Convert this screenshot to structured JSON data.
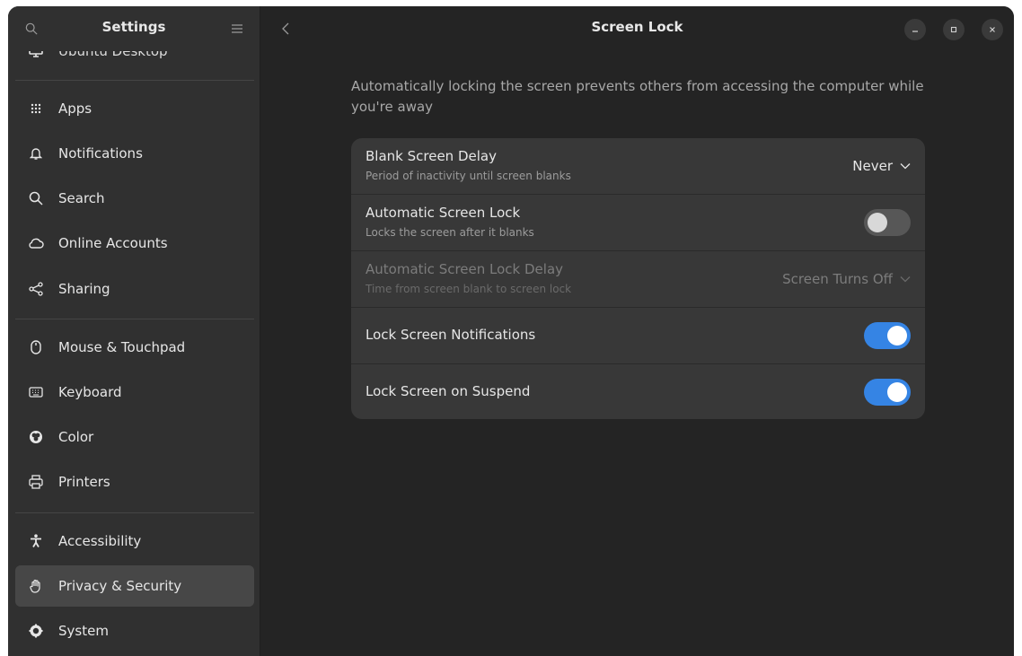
{
  "sidebar": {
    "title": "Settings",
    "partial_item": "Ubuntu Desktop",
    "items": [
      {
        "label": "Apps",
        "icon": "apps-grid-icon"
      },
      {
        "label": "Notifications",
        "icon": "bell-icon"
      },
      {
        "label": "Search",
        "icon": "search-icon"
      },
      {
        "label": "Online Accounts",
        "icon": "cloud-icon"
      },
      {
        "label": "Sharing",
        "icon": "share-icon"
      },
      {
        "label": "Mouse & Touchpad",
        "icon": "mouse-icon"
      },
      {
        "label": "Keyboard",
        "icon": "keyboard-icon"
      },
      {
        "label": "Color",
        "icon": "color-icon"
      },
      {
        "label": "Printers",
        "icon": "printer-icon"
      },
      {
        "label": "Accessibility",
        "icon": "accessibility-icon"
      },
      {
        "label": "Privacy & Security",
        "icon": "hand-icon",
        "active": true
      },
      {
        "label": "System",
        "icon": "gear-icon"
      }
    ]
  },
  "page": {
    "title": "Screen Lock",
    "description": "Automatically locking the screen prevents others from accessing the computer while you're away"
  },
  "settings": {
    "blank_delay": {
      "title": "Blank Screen Delay",
      "subtitle": "Period of inactivity until screen blanks",
      "value": "Never"
    },
    "auto_lock": {
      "title": "Automatic Screen Lock",
      "subtitle": "Locks the screen after it blanks",
      "enabled": false
    },
    "auto_lock_delay": {
      "title": "Automatic Screen Lock Delay",
      "subtitle": "Time from screen blank to screen lock",
      "value": "Screen Turns Off",
      "disabled": true
    },
    "lock_notifications": {
      "title": "Lock Screen Notifications",
      "enabled": true
    },
    "lock_on_suspend": {
      "title": "Lock Screen on Suspend",
      "enabled": true
    }
  },
  "colors": {
    "accent": "#3584e4",
    "window_bg": "#242424",
    "sidebar_bg": "#303030",
    "card_bg": "#383838"
  }
}
